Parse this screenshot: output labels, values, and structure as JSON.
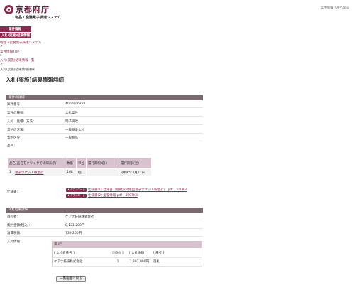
{
  "header": {
    "logo_text": "京都府庁",
    "system_name": "物品・役務電子調達システム",
    "top_link": "案件情報TOPへ戻る"
  },
  "nav": {
    "tab1": "案件情報",
    "tab2": "入札(実施)結果情報"
  },
  "breadcrumb": {
    "items": [
      "物品・役務電子調達システム",
      "案件情報TOP",
      "入札(実施)結果情報一覧",
      "入札(実施)結果情報詳細"
    ],
    "separator": ">"
  },
  "page_title": "入札(実施)結果情報詳細",
  "details": {
    "section_title": "案件の詳細",
    "rows": [
      {
        "label": "案件番号：",
        "value": "4000006731"
      },
      {
        "label": "案件の種類：",
        "value": "入札案件"
      },
      {
        "label": "入札（見積）方法：",
        "value": "電子調達"
      },
      {
        "label": "契約の方法：",
        "value": "一般競争入札"
      },
      {
        "label": "契約区分：",
        "value": "一般物品"
      },
      {
        "label": "品目：",
        "value": ""
      }
    ]
  },
  "items_table": {
    "headers": [
      "品名(品名をクリックで詳細表示)",
      "数量",
      "単位",
      "履行期限(自)",
      "履行期限(至)"
    ],
    "rows": [
      {
        "no": "1",
        "name": "電子ポケット線量計",
        "qty": "168",
        "unit": "個",
        "from": "",
        "to": "令和6年3月22日"
      }
    ]
  },
  "specs": {
    "label": "仕様書：",
    "badge": "ダウンロード",
    "files": [
      "仕様書(1) 仕様書（電磁波対策型電子ポケット線量計）.pdf : 140KB",
      "仕様書(2) 型差情報.pdf : 4507KB"
    ]
  },
  "results": {
    "section_title": "入札結果詳細",
    "rows": [
      {
        "label": "落札者：",
        "value": "ケアナ技研株式会社"
      },
      {
        "label": "契約金額(税込)：",
        "value": "8,131,200円"
      },
      {
        "label": "消費税額：",
        "value": "739,200円"
      },
      {
        "label": "入札情報：",
        "value": ""
      }
    ],
    "round_label": "第1回",
    "table_headers": [
      "[ 入札者氏名 ]",
      "[ 順位 ]",
      "[ 入札金額 ]",
      "[ 備考 ]"
    ],
    "table_rows": [
      {
        "name": "ケアナ技研株式会社",
        "rank": "1",
        "amount": "7,392,000円",
        "note": "落札"
      }
    ]
  },
  "back_button": "一覧画面に戻る",
  "colors": {
    "accent": "#8b2a4f",
    "section": "#7a6a70",
    "table_header": "#d8c2ce"
  }
}
